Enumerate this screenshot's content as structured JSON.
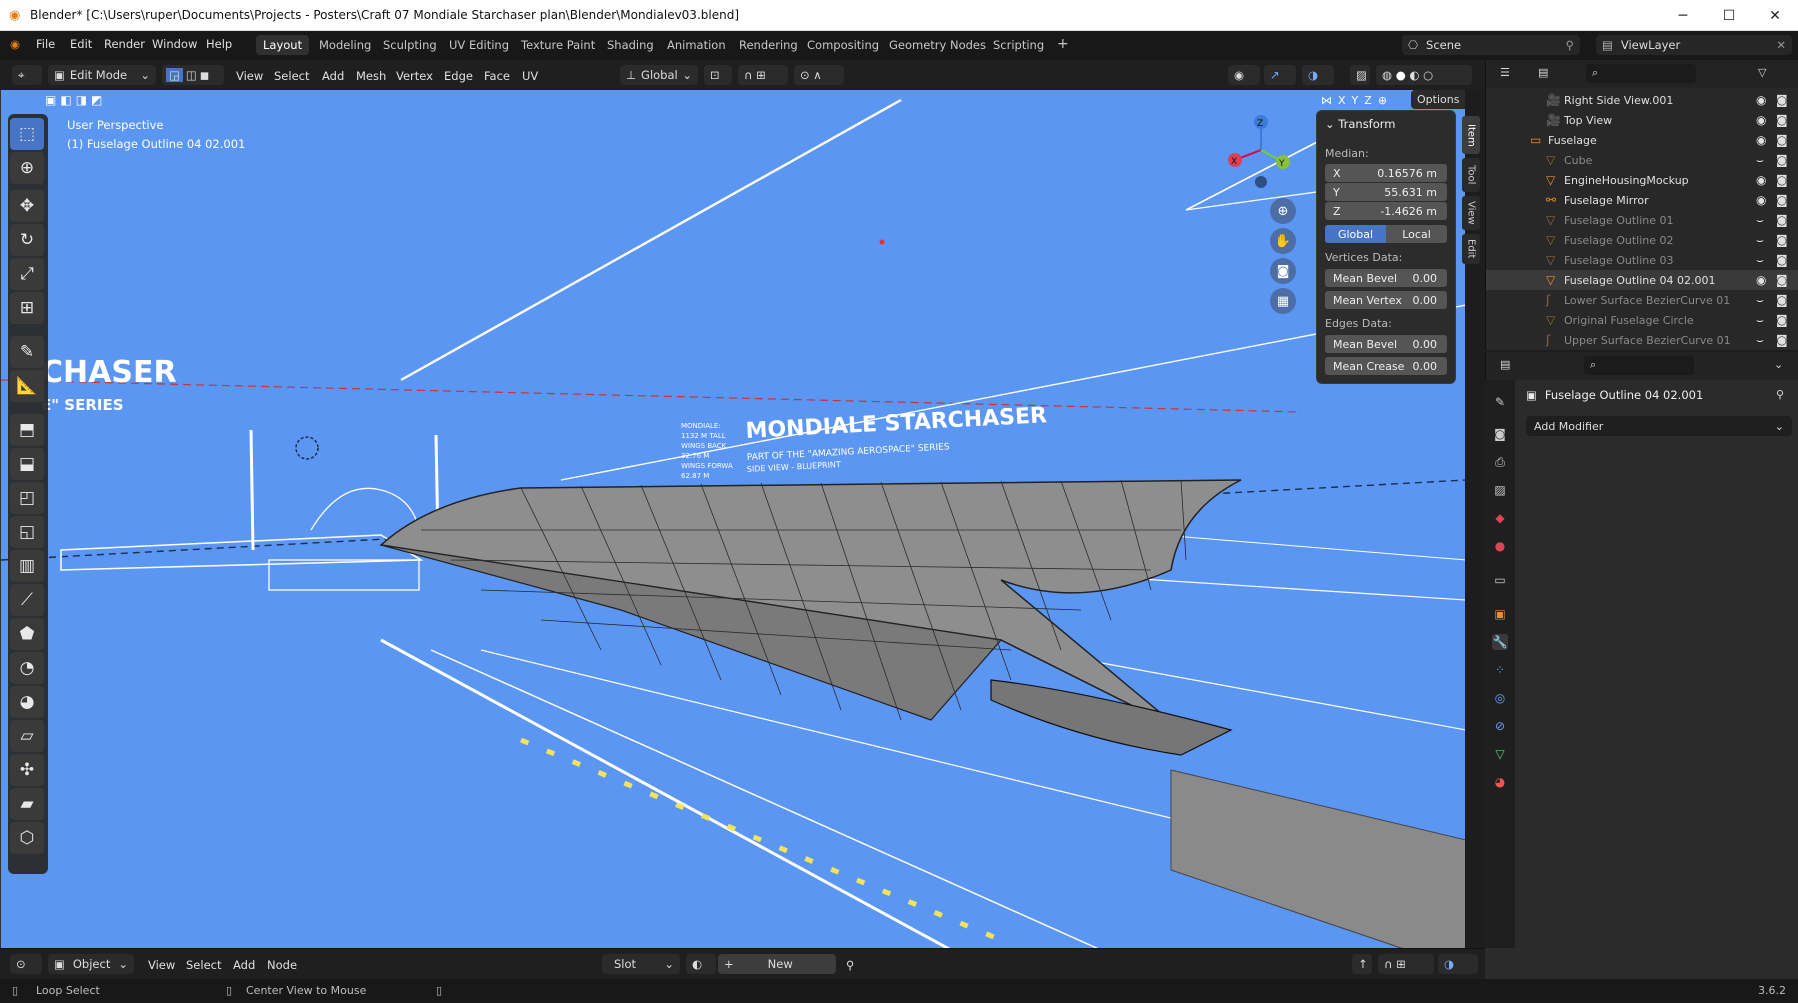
{
  "window": {
    "title": "Blender* [C:\\Users\\ruper\\Documents\\Projects - Posters\\Craft 07 Mondiale Starchaser plan\\Blender\\Mondialev03.blend]"
  },
  "menubar": {
    "items": [
      "File",
      "Edit",
      "Render",
      "Window",
      "Help"
    ]
  },
  "workspaces": [
    "Layout",
    "Modeling",
    "Sculpting",
    "UV Editing",
    "Texture Paint",
    "Shading",
    "Animation",
    "Rendering",
    "Compositing",
    "Geometry Nodes",
    "Scripting"
  ],
  "scene": {
    "label": "Scene"
  },
  "viewlayer": {
    "label": "ViewLayer"
  },
  "header": {
    "mode": "Edit Mode",
    "menus": [
      "View",
      "Select",
      "Add",
      "Mesh",
      "Vertex",
      "Edge",
      "Face",
      "UV"
    ],
    "orientation": "Global",
    "options": "Options",
    "axes": [
      "X",
      "Y",
      "Z"
    ]
  },
  "viewport": {
    "perspective": "User Perspective",
    "object_info": "(1) Fuselage Outline 04 02.001",
    "blueprint": {
      "title": "MONDIALE STARCHASER",
      "subtitle1": "PART OF THE \"AMAZING AEROSPACE\" SERIES",
      "subtitle2": "SIDE VIEW - BLUEPRINT",
      "left_title": "CHASER",
      "left_sub": "E\" SERIES",
      "specs": [
        "MONDIALE:",
        "1132 M TALL",
        "WINGS BACK",
        "32.76 M",
        "WINGS FORWA",
        "62.87 M"
      ]
    }
  },
  "transform": {
    "title": "Transform",
    "median": "Median:",
    "x": {
      "k": "X",
      "v": "0.16576 m"
    },
    "y": {
      "k": "Y",
      "v": "55.631 m"
    },
    "z": {
      "k": "Z",
      "v": "-1.4626 m"
    },
    "global": "Global",
    "local": "Local",
    "vertices_data": "Vertices Data:",
    "mean_bevel_v": {
      "k": "Mean Bevel",
      "v": "0.00"
    },
    "mean_vertex": {
      "k": "Mean Vertex",
      "v": "0.00"
    },
    "edges_data": "Edges Data:",
    "mean_bevel_e": {
      "k": "Mean Bevel",
      "v": "0.00"
    },
    "mean_crease": {
      "k": "Mean Crease",
      "v": "0.00"
    }
  },
  "ntabs": [
    "Item",
    "Tool",
    "View",
    "Edit"
  ],
  "outliner": {
    "rows": [
      {
        "name": "Right Side View.001",
        "dim": false
      },
      {
        "name": "Top View",
        "dim": false
      },
      {
        "name": "Fuselage",
        "dim": false
      },
      {
        "name": "Cube",
        "dim": true
      },
      {
        "name": "EngineHousingMockup",
        "dim": false
      },
      {
        "name": "Fuselage Mirror",
        "dim": false
      },
      {
        "name": "Fuselage Outline 01",
        "dim": true
      },
      {
        "name": "Fuselage Outline 02",
        "dim": true
      },
      {
        "name": "Fuselage Outline 03",
        "dim": true
      },
      {
        "name": "Fuselage Outline 04 02.001",
        "dim": false
      },
      {
        "name": "Lower Surface BezierCurve 01",
        "dim": true
      },
      {
        "name": "Original Fuselage Circle",
        "dim": true
      },
      {
        "name": "Upper Surface BezierCurve 01",
        "dim": true
      }
    ]
  },
  "properties": {
    "object": "Fuselage Outline 04 02.001",
    "add_modifier": "Add Modifier"
  },
  "bottombar": {
    "mode": "Object",
    "menus": [
      "View",
      "Select",
      "Add",
      "Node"
    ],
    "slot": "Slot",
    "new": "New"
  },
  "status": {
    "left": "Loop Select",
    "middle": "Center View to Mouse",
    "version": "3.6.2"
  }
}
